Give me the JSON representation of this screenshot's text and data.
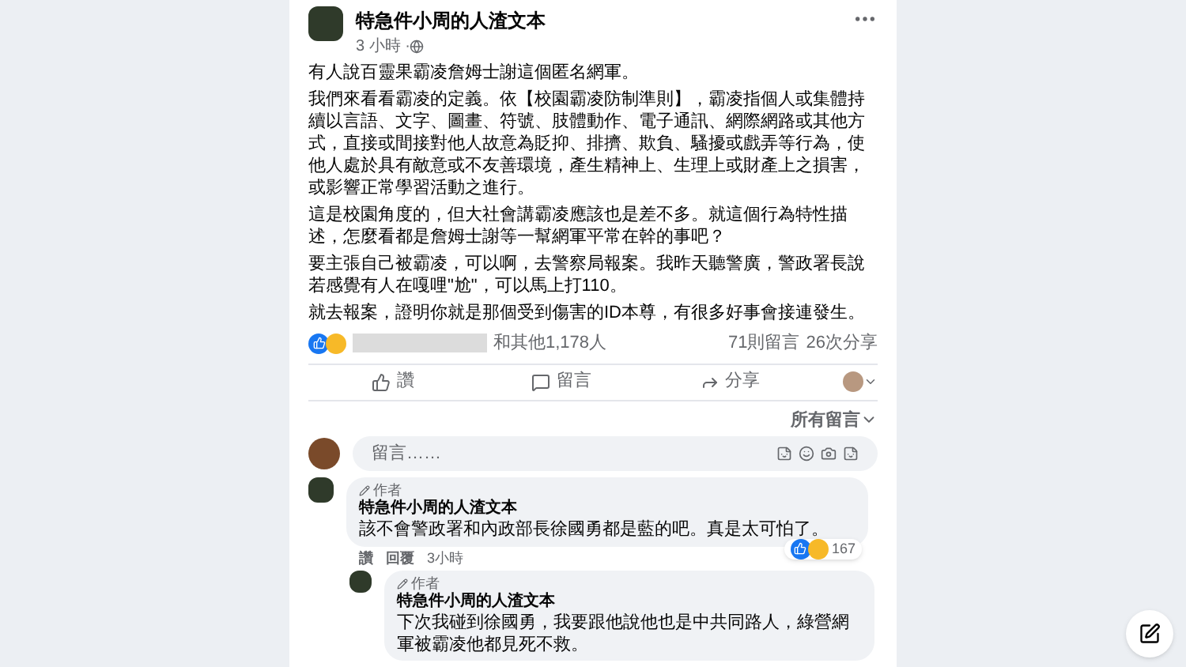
{
  "post": {
    "author": "特急件小周的人渣文本",
    "time": "3 小時 · ",
    "paragraphs": [
      "有人說百靈果霸凌詹姆士謝這個匿名網軍。",
      "我們來看看霸凌的定義。依【校園霸凌防制準則】，霸凌指個人或集體持續以言語、文字、圖畫、符號、肢體動作、電子通訊、網際網路或其他方式，直接或間接對他人故意為貶抑、排擠、欺負、騷擾或戲弄等行為，使他人處於具有敵意或不友善環境，產生精神上、生理上或財產上之損害，或影響正常學習活動之進行。",
      "這是校園角度的，但大社會講霸凌應該也是差不多。就這個行為特性描述，怎麼看都是詹姆士謝等一幫網軍平常在幹的事吧？",
      "要主張自己被霸凌，可以啊，去警察局報案。我昨天聽警廣，警政署長說若感覺有人在嘎哩\"尬\"，可以馬上打110。",
      "就去報案，證明你就是那個受到傷害的ID本尊，有很多好事會接連發生。"
    ],
    "reactions": "和其他1,178人",
    "comments_count": "71則留言",
    "shares_count": "26次分享",
    "actions": [
      "讚",
      "留言",
      "分享"
    ],
    "sort": "所有留言",
    "comment_placeholder": "留言……"
  },
  "comments": [
    {
      "badge": "作者",
      "author": "特急件小周的人渣文本",
      "text": "該不會警政署和內政部長徐國勇都是藍的吧。真是太可怕了。",
      "reaction_count": "167",
      "links": [
        "讚",
        "回覆"
      ],
      "time": "3小時"
    }
  ],
  "replies": [
    {
      "badge": "作者",
      "author": "特急件小周的人渣文本",
      "text": "下次我碰到徐國勇，我要跟他說他也是中共同路人，綠營網軍被霸凌他都見死不救。"
    }
  ]
}
